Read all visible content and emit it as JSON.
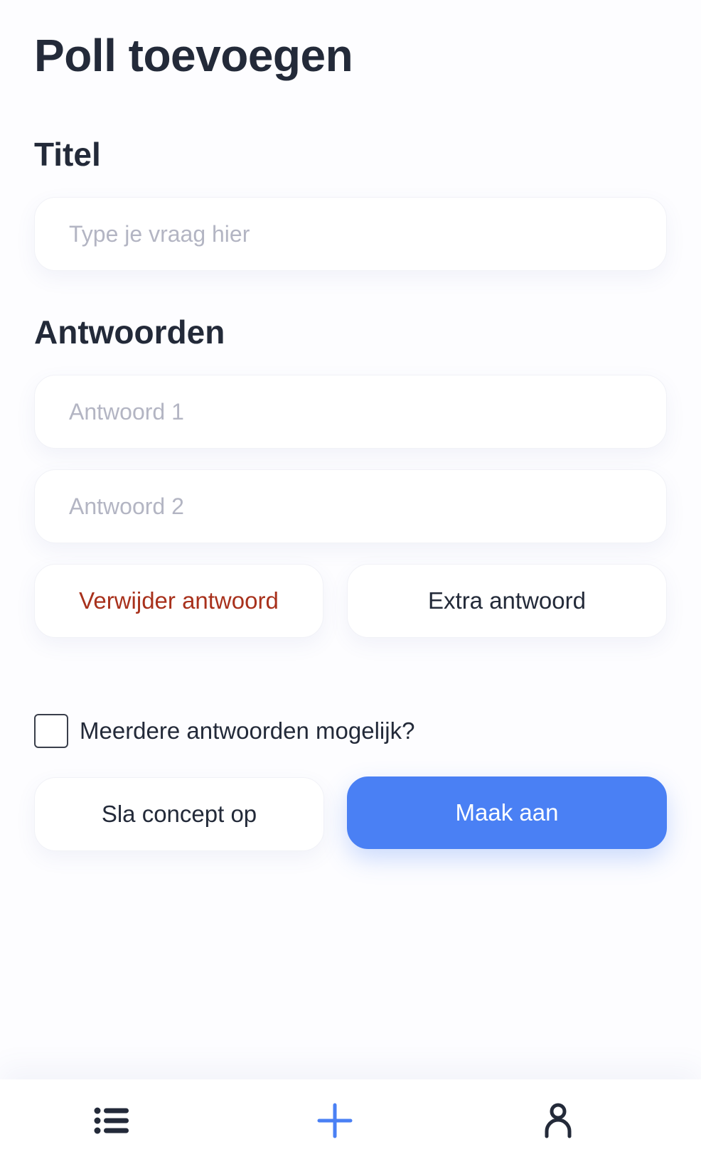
{
  "page": {
    "title": "Poll toevoegen"
  },
  "title_section": {
    "heading": "Titel",
    "input_placeholder": "Type je vraag hier",
    "input_value": ""
  },
  "answers_section": {
    "heading": "Antwoorden",
    "answers": [
      {
        "placeholder": "Antwoord 1",
        "value": ""
      },
      {
        "placeholder": "Antwoord 2",
        "value": ""
      }
    ],
    "remove_label": "Verwijder antwoord",
    "add_label": "Extra antwoord"
  },
  "multiple_answers": {
    "label": "Meerdere antwoorden mogelijk?",
    "checked": false
  },
  "actions": {
    "save_draft_label": "Sla concept op",
    "create_label": "Maak aan"
  },
  "bottom_nav": {
    "items": [
      {
        "icon": "list-icon",
        "active": false
      },
      {
        "icon": "plus-icon",
        "active": true
      },
      {
        "icon": "user-icon",
        "active": false
      }
    ]
  },
  "colors": {
    "primary": "#4a80f4",
    "danger": "#a8311c",
    "text": "#232a39",
    "placeholder": "#b3b5c3"
  }
}
